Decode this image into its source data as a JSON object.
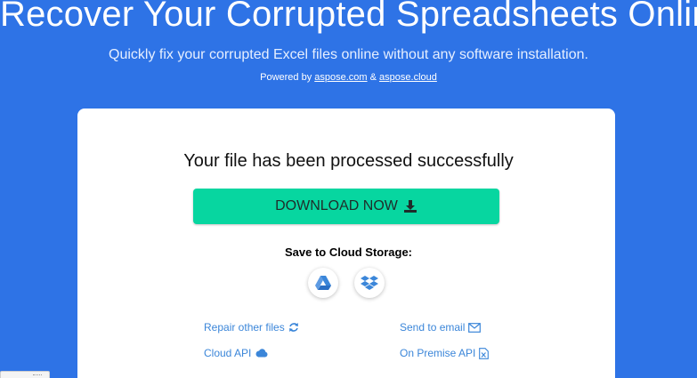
{
  "header": {
    "title": "Recover Your Corrupted Spreadsheets Online",
    "subtitle": "Quickly fix your corrupted Excel files online without any software installation.",
    "powered_prefix": "Powered by",
    "powered_link1": "aspose.com",
    "powered_amp": "&",
    "powered_link2": "aspose.cloud"
  },
  "card": {
    "result_title": "Your file has been processed successfully",
    "download_label": "DOWNLOAD NOW",
    "save_label": "Save to Cloud Storage:",
    "cloud_buttons": [
      "google-drive-icon",
      "dropbox-icon"
    ],
    "links": {
      "repair": "Repair other files",
      "email": "Send to email",
      "cloud_api": "Cloud API",
      "on_premise": "On Premise API"
    }
  },
  "colors": {
    "background": "#2e73e6",
    "download_button": "#07d6a0",
    "link": "#3b86d9"
  }
}
